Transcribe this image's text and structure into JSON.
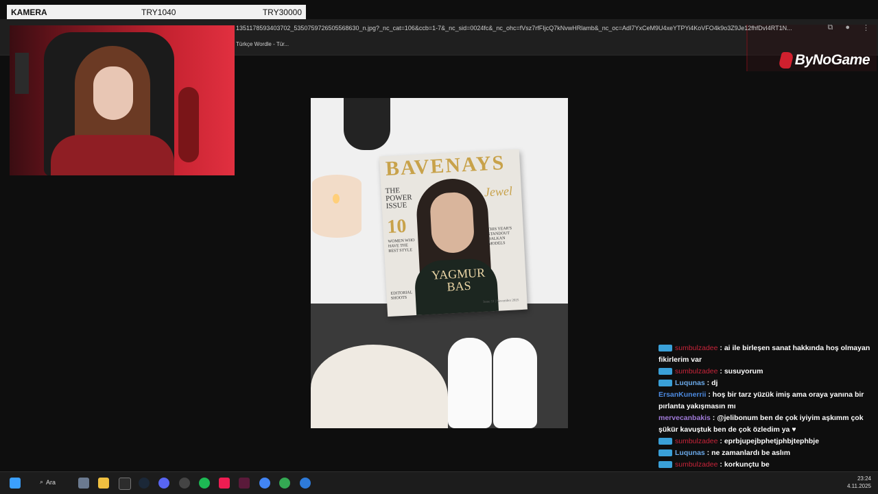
{
  "overlay": {
    "camera_label": "KAMERA",
    "donation1": "TRY1040",
    "donation2": "TRY30000"
  },
  "browser": {
    "url": "1351178593403702_5350759726505568630_n.jpg?_nc_cat=106&ccb=1-7&_nc_sid=0024fc&_nc_ohc=fVsz7rfFIjcQ7kNvwHRlamb&_nc_oc=AdI7YxCeM9U4xeYTPYi4KoVFO4k9o3Z9Je12fhfDvI4RT1N...",
    "bookmark": "Türkçe Wordle - Tür..."
  },
  "logo": {
    "text": "ByNoGame",
    "color": "#d0202e"
  },
  "magazine": {
    "title": "BAVENAYS",
    "left_top": "THE POWER ISSUE",
    "number": "10",
    "left_sub": "WOMEN WHO HAVE THE BEST STYLE",
    "right_word": "Jewel",
    "right_sub": "THIS YEAR'S STANDOUT BALKAN MODELS",
    "name": "YAGMUR BAS",
    "editorial": "EDITORIAL SHOOTS",
    "issue": "Issue 11 | November 2025"
  },
  "chat": {
    "messages": [
      {
        "user": "sumbulzadee",
        "color": "red",
        "badge": true,
        "text": "ai ile birleşen sanat hakkında hoş olmayan fikirlerim var"
      },
      {
        "user": "sumbulzadee",
        "color": "red",
        "badge": true,
        "text": "susuyorum"
      },
      {
        "user": "Luqunas",
        "color": "lightblue",
        "badge": true,
        "text": "dj"
      },
      {
        "user": "ErsanKunerrii",
        "color": "blue",
        "badge": false,
        "text": "hoş bir tarz yüzük imiş ama oraya yanına bir pırlanta yakışmasın mı"
      },
      {
        "user": "mervecanbakis",
        "color": "purple",
        "badge": false,
        "text": "@jelibonum ben de çok iyiyim aşkımm çok şükür kavuştuk ben de çok özledim ya ♥"
      },
      {
        "user": "sumbulzadee",
        "color": "red",
        "badge": true,
        "text": "eprbjupejbphetjphbjtephbje"
      },
      {
        "user": "Luqunas",
        "color": "lightblue",
        "badge": true,
        "text": "ne zamanlardı be aslım"
      },
      {
        "user": "sumbulzadee",
        "color": "red",
        "badge": true,
        "text": "korkunçtu be"
      }
    ]
  },
  "taskbar": {
    "search_label": "Ara",
    "time": "23:24",
    "date": "4.11.2025"
  }
}
